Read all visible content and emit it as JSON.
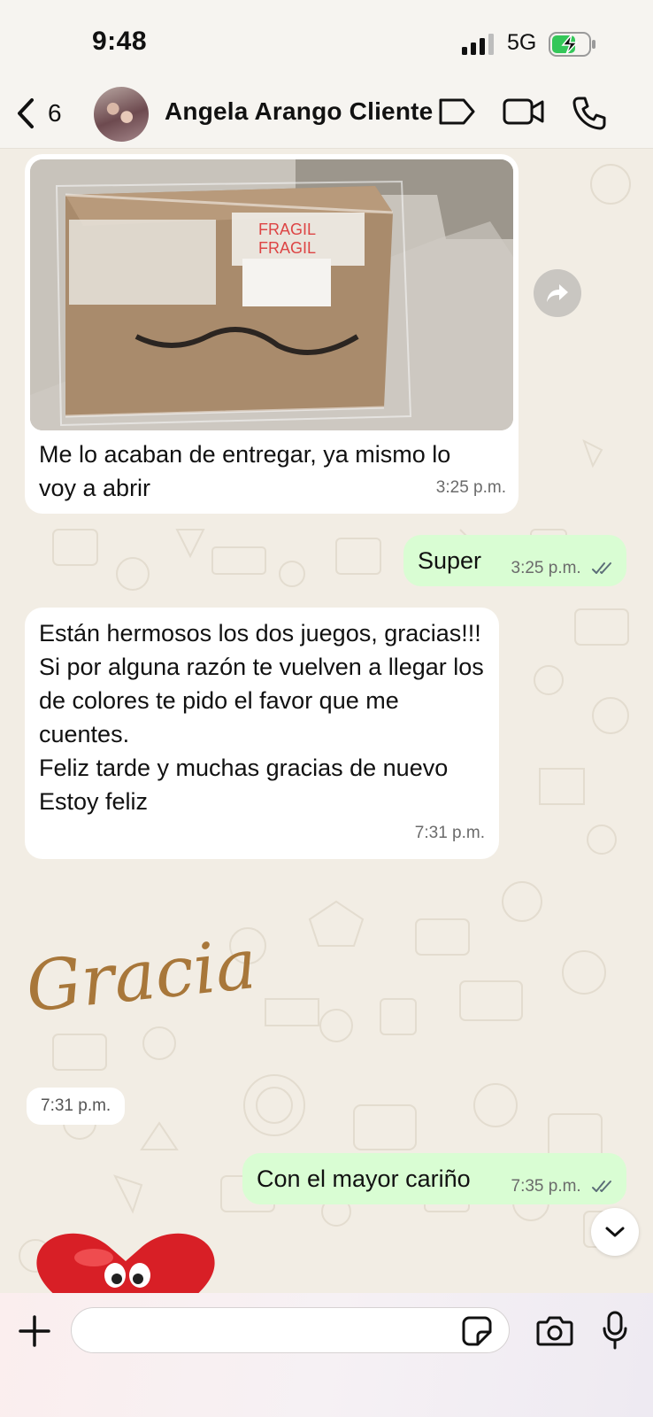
{
  "status_bar": {
    "time": "9:48",
    "network": "5G"
  },
  "header": {
    "back_count": "6",
    "contact_name": "Angela Arango Cliente"
  },
  "photo": {
    "label_line1": "FRAGIL",
    "label_line2": "FRAGIL"
  },
  "messages": [
    {
      "direction": "in",
      "text": "Me lo acaban de entregar, ya mismo lo voy a abrir",
      "time": "3:25 p.m."
    },
    {
      "direction": "out",
      "text": "Super",
      "time": "3:25 p.m."
    },
    {
      "direction": "in",
      "text": "Están hermosos los dos juegos, gracias!!!\nSi por alguna razón te vuelven a llegar los de colores te pido el favor que me cuentes.\nFeliz tarde y muchas gracias de nuevo\nEstoy feliz",
      "time": "7:31 p.m."
    },
    {
      "direction": "in",
      "text": "Gracias!",
      "time": "7:31 p.m."
    },
    {
      "direction": "out",
      "text": "Con el mayor cariño",
      "time": "7:35 p.m."
    }
  ],
  "composer": {
    "placeholder": ""
  },
  "colors": {
    "incoming": "#ffffff",
    "outgoing": "#d9fdd3",
    "wallpaper": "#f2ede4",
    "ticks": "#5c6e78"
  }
}
